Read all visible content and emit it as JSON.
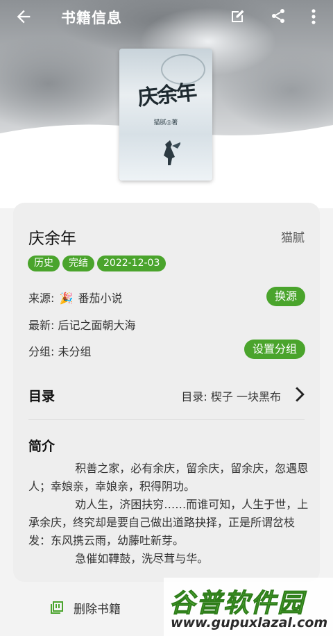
{
  "appbar": {
    "title": "书籍信息",
    "icons": [
      "arrow-back-icon",
      "edit-icon",
      "share-icon",
      "more-vert-icon"
    ]
  },
  "cover": {
    "title": "庆余年",
    "author_line": "猫腻◎著"
  },
  "book": {
    "name": "庆余年",
    "author": "猫腻",
    "tags": [
      "历史",
      "完结",
      "2022-12-03"
    ]
  },
  "info": {
    "source_label": "来源:",
    "source_icon": "🎉",
    "source_value": "番茄小说",
    "change_source_button": "换源",
    "latest": "最新: 后记之面朝大海",
    "group": "分组: 未分组",
    "set_group_button": "设置分组"
  },
  "toc": {
    "label": "目录",
    "value": "目录: 楔子 一块黑布"
  },
  "intro": {
    "label": "简介",
    "paragraphs": [
      "积善之家，必有余庆，留余庆，留余庆，忽遇恩人；幸娘亲，幸娘亲，积得阴功。",
      "劝人生，济困扶穷……而谁可知，人生于世，上承余庆，终究却是要自己做出道路抉择，正是所谓岔枝发：东风携云雨，幼藤吐新芽。",
      "急催如鞾鼓，洗尽茸与华。"
    ]
  },
  "bottom": {
    "delete_label": "删除书籍"
  },
  "watermark": {
    "cn": "谷普软件园",
    "url": "www.gupuxlazal.com"
  },
  "colors": {
    "accent": "#4aa42c",
    "card": "#eeeeee"
  }
}
